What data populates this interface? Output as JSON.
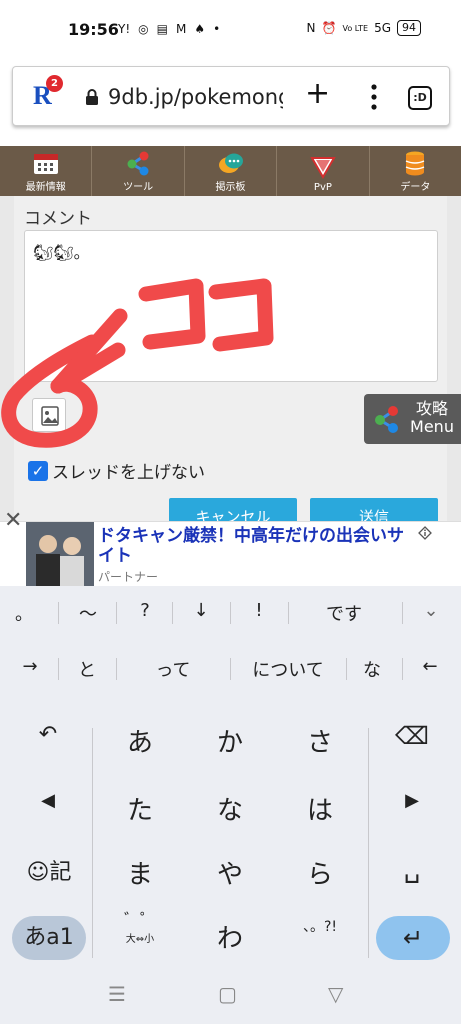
{
  "status_bar": {
    "time": "19:56",
    "left_icons": [
      "Y!",
      "◎",
      "▤",
      "M",
      "♠",
      "•"
    ],
    "right_icons": [
      "N",
      "⏰",
      "Vo LTE",
      "5G"
    ],
    "battery": "94"
  },
  "browser": {
    "notification_count": "2",
    "url": "9db.jp/pokemong",
    "tabs_icon_text": ":D"
  },
  "site_nav": {
    "items": [
      {
        "label": "最新情報",
        "icon": "calendar-icon"
      },
      {
        "label": "ツール",
        "icon": "share-icon"
      },
      {
        "label": "掲示板",
        "icon": "chat-icon"
      },
      {
        "label": "PvP",
        "icon": "pvp-icon"
      },
      {
        "label": "データ",
        "icon": "database-icon"
      }
    ]
  },
  "comment_form": {
    "heading": "コメント",
    "textarea_value": "🐿🐿。",
    "handwritten_annotation": "ココ",
    "checkbox_label": "スレッドを上げない",
    "checkbox_checked": true,
    "cancel_label": "キャンセル",
    "send_label": "送信"
  },
  "side_menu": {
    "label_top": "攻略",
    "label_bottom": "Menu"
  },
  "ad": {
    "title": "ドタキャン厳禁！中高年だけの出会いサイト",
    "sponsor": "パートナー",
    "close": "✕"
  },
  "keyboard": {
    "row1": [
      "。",
      "〜",
      "?",
      "↓",
      "!",
      "です",
      "⌄"
    ],
    "row2": [
      "→",
      "と",
      "って",
      "について",
      "な",
      "←"
    ],
    "grid": [
      [
        "↶",
        "あ",
        "か",
        "さ",
        "⌫"
      ],
      [
        "◀",
        "た",
        "な",
        "は",
        "▶"
      ],
      [
        "☺記",
        "ま",
        "や",
        "ら",
        "␣"
      ],
      [
        "あa1",
        "゛゜",
        "わ",
        "、。?!",
        "↵"
      ]
    ],
    "dakuten_sub": "大⇔小"
  },
  "system_nav": {
    "recents": "☰",
    "home": "▢",
    "back": "▽"
  },
  "colors": {
    "nav_bg": "#6b5a48",
    "button_blue": "#2aa8dc",
    "annotation_red": "#f04a4a",
    "checkbox_blue": "#1a73e8",
    "ad_title": "#1a33b8"
  }
}
